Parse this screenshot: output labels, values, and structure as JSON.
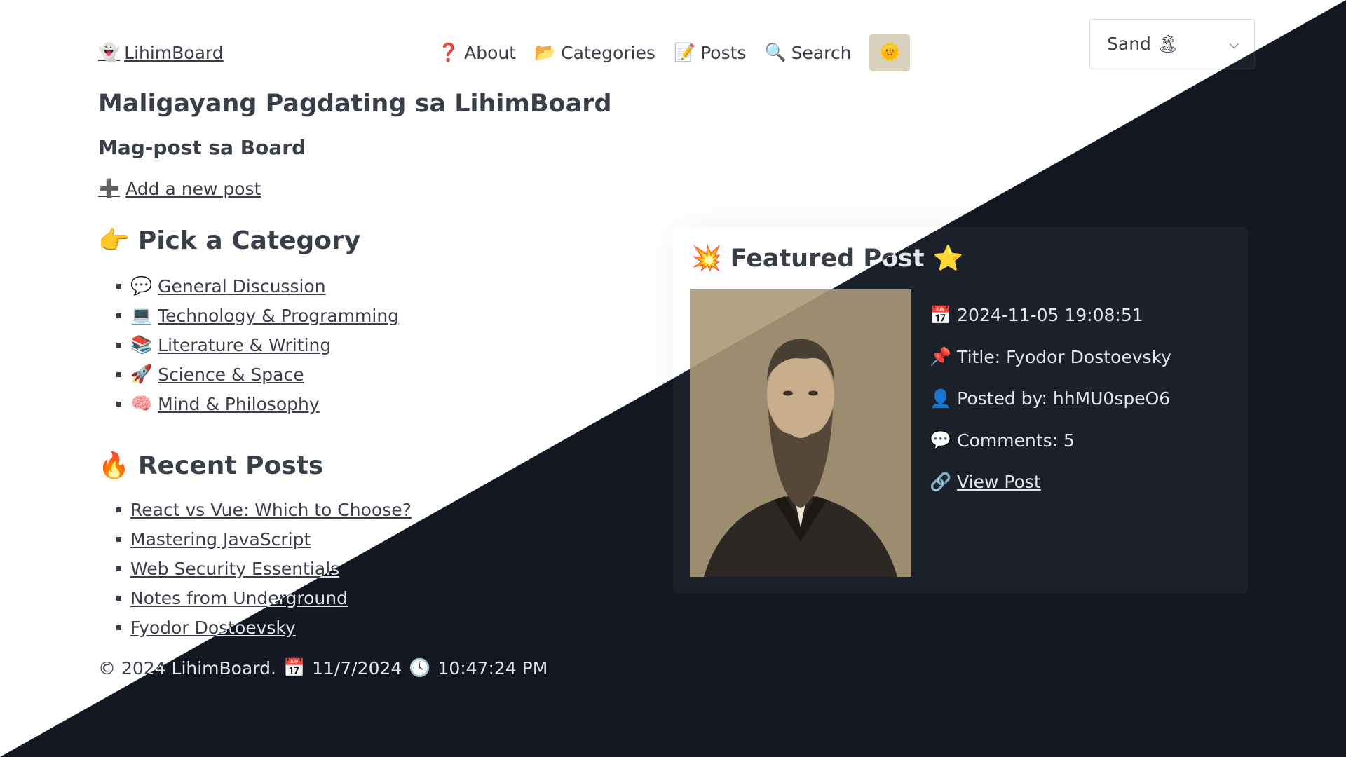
{
  "brand": {
    "icon": "ghost-icon",
    "glyph": "👻",
    "label": "LihimBoard"
  },
  "nav": [
    {
      "icon": "question-icon",
      "glyph": "❓",
      "label": "About"
    },
    {
      "icon": "folder-icon",
      "glyph": "📂",
      "label": "Categories"
    },
    {
      "icon": "memo-icon",
      "glyph": "📝",
      "label": "Posts"
    },
    {
      "icon": "search-icon",
      "glyph": "🔍",
      "label": "Search"
    }
  ],
  "theme_toggle": {
    "icon": "sun-icon",
    "glyph": "🌞"
  },
  "theme_select": {
    "value": "Sand",
    "icon": "palette-icon",
    "glyph": "🏝"
  },
  "welcome": {
    "title": "Maligayang Pagdating sa LihimBoard",
    "subtitle": "Mag-post sa Board",
    "add_post": {
      "icon": "plus-icon",
      "glyph": "➕",
      "label": "Add a new post"
    }
  },
  "categories": {
    "title": "Pick a Category",
    "icon": "pointing-hand-icon",
    "glyph": "👉",
    "items": [
      {
        "icon": "speech-bubble-icon",
        "glyph": "💬",
        "label": "General Discussion"
      },
      {
        "icon": "laptop-icon",
        "glyph": "💻",
        "label": "Technology & Programming"
      },
      {
        "icon": "books-icon",
        "glyph": "📚",
        "label": "Literature & Writing"
      },
      {
        "icon": "rocket-icon",
        "glyph": "🚀",
        "label": "Science & Space"
      },
      {
        "icon": "brain-icon",
        "glyph": "🧠",
        "label": "Mind & Philosophy"
      }
    ]
  },
  "recent": {
    "title": "Recent Posts",
    "icon": "fire-icon",
    "glyph": "🔥",
    "items": [
      "React vs Vue: Which to Choose?",
      "Mastering JavaScript",
      "Web Security Essentials",
      "Notes from Underground",
      "Fyodor Dostoevsky"
    ]
  },
  "featured": {
    "title": "Featured Post",
    "icon_left": "sparkle-icon",
    "glyph_left": "💥",
    "icon_right": "star-icon",
    "glyph_right": "⭐",
    "date": {
      "icon": "calendar-icon",
      "glyph": "📅",
      "text": "2024-11-05 19:08:51"
    },
    "post_title": {
      "icon": "pushpin-icon",
      "glyph": "📌",
      "text": "Title: Fyodor Dostoevsky"
    },
    "author": {
      "icon": "user-icon",
      "glyph": "👤",
      "text": "Posted by: hhMU0speO6"
    },
    "comments": {
      "icon": "comment-icon",
      "glyph": "💬",
      "text": "Comments: 5"
    },
    "link": {
      "icon": "link-icon",
      "glyph": "🔗",
      "text": "View Post"
    }
  },
  "footer": {
    "copyright": "© 2024 LihimBoard.",
    "date_icon": "calendar-icon",
    "date_glyph": "📅",
    "date": "11/7/2024",
    "time_icon": "clock-icon",
    "time_glyph": "🕓",
    "time": "10:47:24 PM"
  },
  "colors": {
    "light_bg": "#ffffff",
    "dark_bg": "#131722",
    "light_text": "#3a3e48",
    "dark_text": "#e4e6ea",
    "card_dark": "#1c202b"
  }
}
